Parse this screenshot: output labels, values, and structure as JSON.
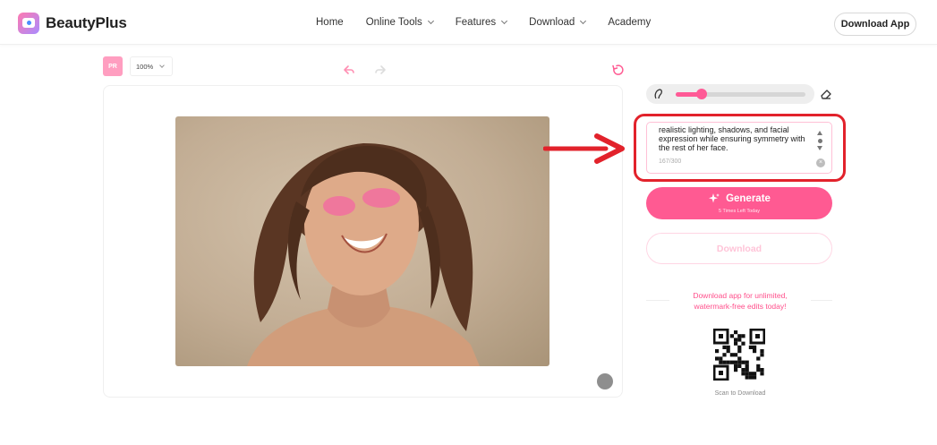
{
  "header": {
    "logo_text": "BeautyPlus",
    "nav": [
      {
        "label": "Home",
        "has_dropdown": false
      },
      {
        "label": "Online Tools",
        "has_dropdown": true
      },
      {
        "label": "Features",
        "has_dropdown": true
      },
      {
        "label": "Download",
        "has_dropdown": true
      },
      {
        "label": "Academy",
        "has_dropdown": false
      }
    ],
    "download_app_label": "Download App"
  },
  "toolbar": {
    "avatar_label": "PR",
    "zoom": "100%",
    "icons": [
      "undo-icon",
      "redo-icon",
      "reset-icon"
    ]
  },
  "canvas": {
    "image_description_icon": "photo",
    "compare_icon": "compare-icon"
  },
  "brush": {
    "size_level": 0.2
  },
  "prompt": {
    "text": "realistic lighting, shadows, and facial expression while ensuring symmetry with the rest of her face.",
    "count": "167/300"
  },
  "generate": {
    "label": "Generate",
    "sublabel": "5 Times Left Today"
  },
  "download_label": "Download",
  "promo": {
    "line1": "Download app for unlimited,",
    "line2": "watermark-free edits today!"
  },
  "qr_caption": "Scan to Download",
  "colors": {
    "accent": "#ff5a92",
    "highlight_outline": "#e2222b"
  }
}
